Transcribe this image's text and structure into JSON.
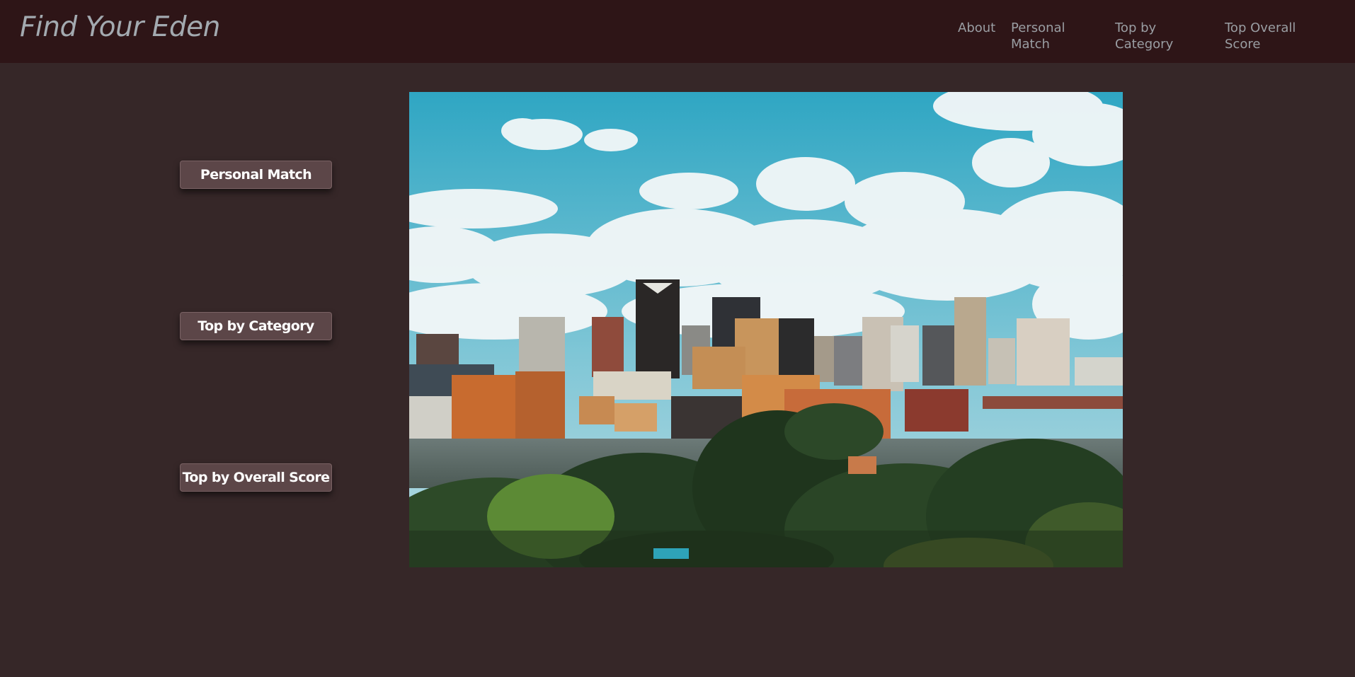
{
  "header": {
    "brand": "Find Your Eden",
    "nav": {
      "about": "About",
      "personal_match": "Personal Match",
      "top_by_category": "Top by Category",
      "top_overall_score": "Top Overall Score"
    }
  },
  "sidebar": {
    "personal_match": "Personal Match",
    "top_by_category": "Top by Category",
    "top_by_overall_score": "Top by Overall Score"
  },
  "colors": {
    "page_background": "#362728",
    "navbar_background": "#2e1517",
    "button_background": "#5c4648",
    "sky": "#35a9c4"
  },
  "hero": {
    "subject": "city skyline photo"
  }
}
